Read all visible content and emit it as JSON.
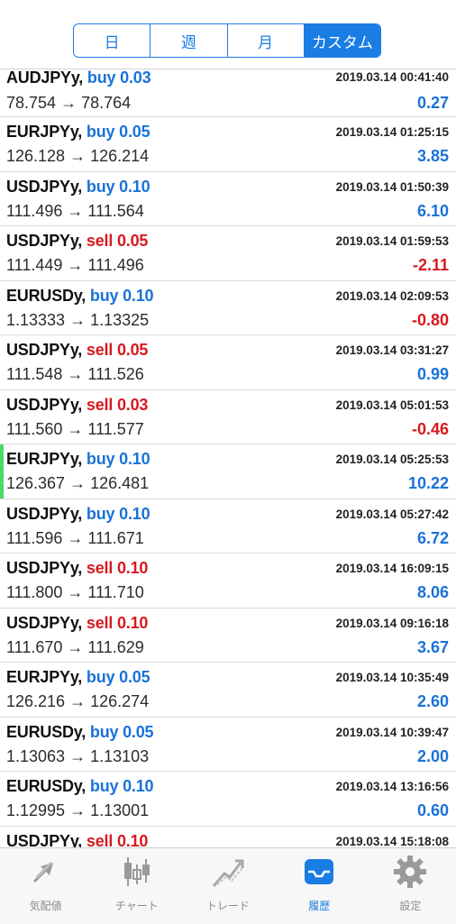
{
  "periods": [
    "日",
    "週",
    "月",
    "カスタム"
  ],
  "active_period": 3,
  "trades": [
    {
      "symbol": "AUDJPYy,",
      "side": "buy",
      "volume": "0.03",
      "open": "78.754",
      "close": "78.764",
      "time": "2019.03.14 00:41:40",
      "profit": "0.27",
      "sign": "pos"
    },
    {
      "symbol": "EURJPYy,",
      "side": "buy",
      "volume": "0.05",
      "open": "126.128",
      "close": "126.214",
      "time": "2019.03.14 01:25:15",
      "profit": "3.85",
      "sign": "pos"
    },
    {
      "symbol": "USDJPYy,",
      "side": "buy",
      "volume": "0.10",
      "open": "111.496",
      "close": "111.564",
      "time": "2019.03.14 01:50:39",
      "profit": "6.10",
      "sign": "pos"
    },
    {
      "symbol": "USDJPYy,",
      "side": "sell",
      "volume": "0.05",
      "open": "111.449",
      "close": "111.496",
      "time": "2019.03.14 01:59:53",
      "profit": "-2.11",
      "sign": "neg"
    },
    {
      "symbol": "EURUSDy,",
      "side": "buy",
      "volume": "0.10",
      "open": "1.13333",
      "close": "1.13325",
      "time": "2019.03.14 02:09:53",
      "profit": "-0.80",
      "sign": "neg"
    },
    {
      "symbol": "USDJPYy,",
      "side": "sell",
      "volume": "0.05",
      "open": "111.548",
      "close": "111.526",
      "time": "2019.03.14 03:31:27",
      "profit": "0.99",
      "sign": "pos"
    },
    {
      "symbol": "USDJPYy,",
      "side": "sell",
      "volume": "0.03",
      "open": "111.560",
      "close": "111.577",
      "time": "2019.03.14 05:01:53",
      "profit": "-0.46",
      "sign": "neg"
    },
    {
      "symbol": "EURJPYy,",
      "side": "buy",
      "volume": "0.10",
      "open": "126.367",
      "close": "126.481",
      "time": "2019.03.14 05:25:53",
      "profit": "10.22",
      "sign": "pos",
      "marked": true
    },
    {
      "symbol": "USDJPYy,",
      "side": "buy",
      "volume": "0.10",
      "open": "111.596",
      "close": "111.671",
      "time": "2019.03.14 05:27:42",
      "profit": "6.72",
      "sign": "pos"
    },
    {
      "symbol": "USDJPYy,",
      "side": "sell",
      "volume": "0.10",
      "open": "111.800",
      "close": "111.710",
      "time": "2019.03.14 16:09:15",
      "profit": "8.06",
      "sign": "pos"
    },
    {
      "symbol": "USDJPYy,",
      "side": "sell",
      "volume": "0.10",
      "open": "111.670",
      "close": "111.629",
      "time": "2019.03.14 09:16:18",
      "profit": "3.67",
      "sign": "pos"
    },
    {
      "symbol": "EURJPYy,",
      "side": "buy",
      "volume": "0.05",
      "open": "126.216",
      "close": "126.274",
      "time": "2019.03.14 10:35:49",
      "profit": "2.60",
      "sign": "pos"
    },
    {
      "symbol": "EURUSDy,",
      "side": "buy",
      "volume": "0.05",
      "open": "1.13063",
      "close": "1.13103",
      "time": "2019.03.14 10:39:47",
      "profit": "2.00",
      "sign": "pos"
    },
    {
      "symbol": "EURUSDy,",
      "side": "buy",
      "volume": "0.10",
      "open": "1.12995",
      "close": "1.13001",
      "time": "2019.03.14 13:16:56",
      "profit": "0.60",
      "sign": "pos"
    },
    {
      "symbol": "USDJPYy,",
      "side": "sell",
      "volume": "0.10",
      "open": "",
      "close": "",
      "time": "2019.03.14 15:18:08",
      "profit": "",
      "sign": "pos"
    }
  ],
  "tabs": [
    {
      "label": "気配値",
      "icon": "quotes-arrows-icon"
    },
    {
      "label": "チャート",
      "icon": "candlestick-chart-icon"
    },
    {
      "label": "トレード",
      "icon": "trade-trend-icon"
    },
    {
      "label": "履歴",
      "icon": "history-inbox-icon"
    },
    {
      "label": "設定",
      "icon": "settings-gear-icon"
    }
  ],
  "active_tab": 3,
  "colors": {
    "accent": "#1a7de3",
    "buy": "#1a72d8",
    "sell": "#d7191e",
    "tab_inactive": "#8c8c8c",
    "marker": "#4cd964"
  }
}
